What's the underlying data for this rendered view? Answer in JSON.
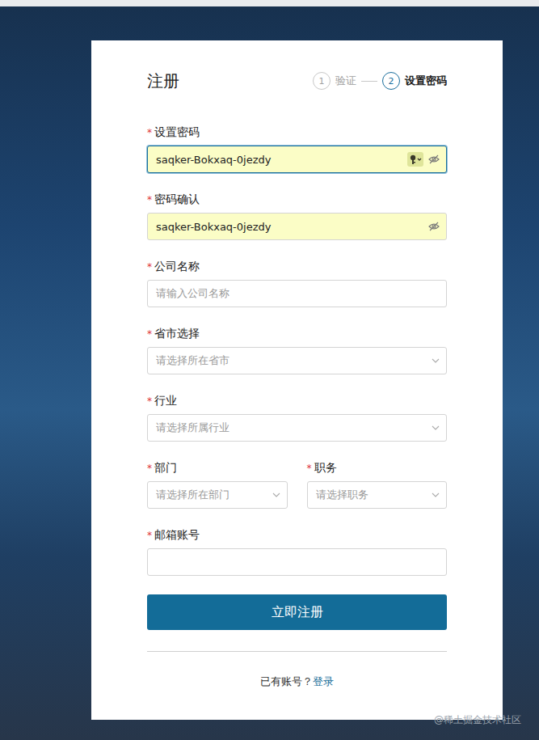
{
  "page": {
    "watermark": "@稀土掘金技术社区"
  },
  "title": "注册",
  "steps": [
    {
      "number": "1",
      "label": "验证",
      "selected": false
    },
    {
      "number": "2",
      "label": "设置密码",
      "selected": true
    }
  ],
  "required_mark": "*",
  "rows": [
    {
      "fields": [
        {
          "label": "设置密码",
          "kind": "password",
          "value": "saqker-Bokxaq-0jezdy",
          "placeholder": "",
          "required": true,
          "focused": true,
          "autofilled": true,
          "password_visible": false,
          "key_button": true
        }
      ]
    },
    {
      "fields": [
        {
          "label": "密码确认",
          "kind": "password",
          "value": "saqker-Bokxaq-0jezdy",
          "placeholder": "",
          "required": true,
          "focused": false,
          "autofilled": true,
          "password_visible": false,
          "key_button": false
        }
      ]
    },
    {
      "fields": [
        {
          "label": "公司名称",
          "kind": "text",
          "value": "",
          "placeholder": "请输入公司名称",
          "required": true,
          "focused": false,
          "autofilled": false
        }
      ]
    },
    {
      "fields": [
        {
          "label": "省市选择",
          "kind": "select",
          "value": "",
          "placeholder": "请选择所在省市",
          "required": true,
          "focused": false,
          "autofilled": false
        }
      ]
    },
    {
      "fields": [
        {
          "label": "行业",
          "kind": "select",
          "value": "",
          "placeholder": "请选择所属行业",
          "required": true,
          "focused": false,
          "autofilled": false
        }
      ]
    },
    {
      "fields": [
        {
          "label": "部门",
          "kind": "select",
          "value": "",
          "placeholder": "请选择所在部门",
          "required": true,
          "focused": false,
          "autofilled": false
        },
        {
          "label": "职务",
          "kind": "select",
          "value": "",
          "placeholder": "请选择职务",
          "required": true,
          "focused": false,
          "autofilled": false
        }
      ]
    },
    {
      "fields": [
        {
          "label": "邮箱账号",
          "kind": "text",
          "value": "",
          "placeholder": "",
          "required": true,
          "focused": false,
          "autofilled": false
        }
      ]
    }
  ],
  "submit": {
    "label": "立即注册"
  },
  "footer": {
    "prompt": "已有账号？",
    "link": "登录"
  }
}
